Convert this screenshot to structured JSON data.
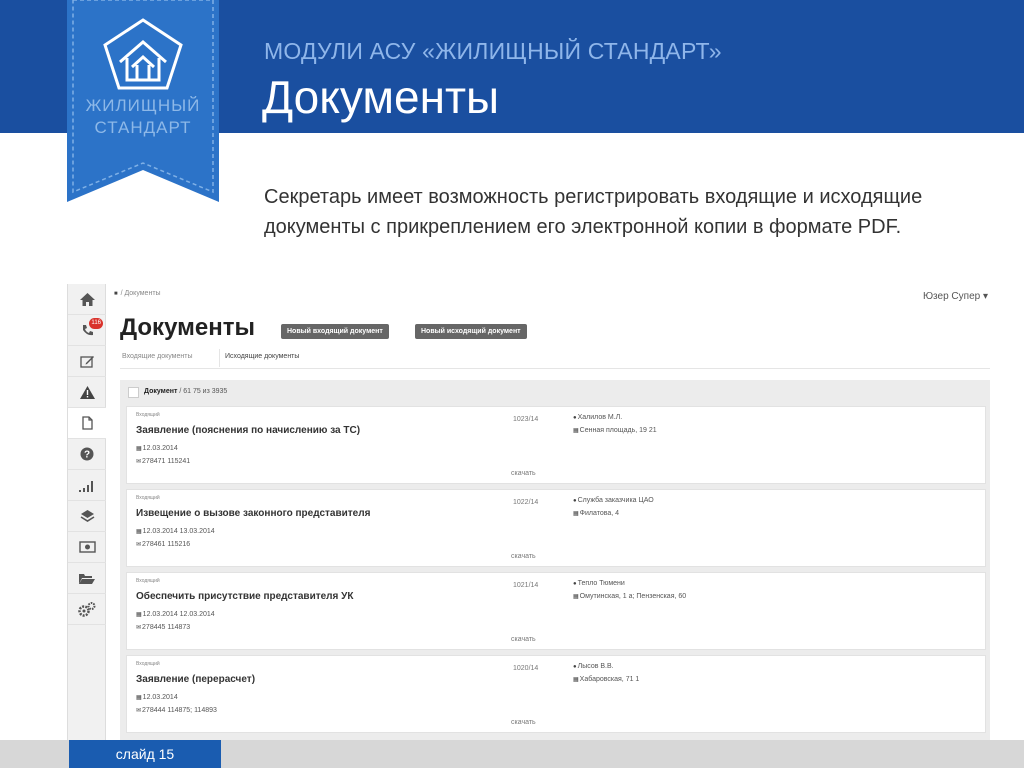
{
  "header": {
    "module_title": "МОДУЛИ АСУ «ЖИЛИЩНЫЙ СТАНДАРТ»",
    "page_heading": "Документы",
    "logo_line1": "ЖИЛИЩНЫЙ",
    "logo_line2": "СТАНДАРТ"
  },
  "description": "Секретарь имеет возможность регистрировать входящие и исходящие документы с прикреплением его электронной копии в формате PDF.",
  "app": {
    "sidebar": [
      {
        "icon": "home-icon",
        "badge": ""
      },
      {
        "icon": "phone-icon",
        "badge": "116"
      },
      {
        "icon": "edit-icon",
        "badge": ""
      },
      {
        "icon": "warning-icon",
        "badge": ""
      },
      {
        "icon": "document-icon",
        "badge": "",
        "active": true
      },
      {
        "icon": "question-icon",
        "badge": ""
      },
      {
        "icon": "signal-icon",
        "badge": ""
      },
      {
        "icon": "layers-icon",
        "badge": ""
      },
      {
        "icon": "money-icon",
        "badge": ""
      },
      {
        "icon": "folder-icon",
        "badge": ""
      },
      {
        "icon": "cogs-icon",
        "badge": ""
      }
    ],
    "breadcrumb": "Документы",
    "user_menu": "Юзер Супер ▾",
    "title": "Документы",
    "new_incoming_button": "Новый входящий документ",
    "new_outgoing_button": "Новый исходящий документ",
    "tabs": [
      "Входящие документы",
      "Исходящие документы"
    ],
    "list_label": "Документ",
    "list_count": " / 61 75 из 3935",
    "rows": [
      {
        "type": "Входящий",
        "title": "Заявление (пояснения по начислению за ТС)",
        "dates": "12.03.2014",
        "codes": "278471  115241",
        "number": "1023/14",
        "author": "Халилов М.Л.",
        "address": "Сенная площадь, 19   21",
        "download": "скачать"
      },
      {
        "type": "Входящий",
        "title": "Извещение о вызове законного представителя",
        "dates": "12.03.2014  13.03.2014",
        "codes": "278461  115216",
        "number": "1022/14",
        "author": "Служба заказчика ЦАО",
        "address": "Филатова, 4",
        "download": "скачать"
      },
      {
        "type": "Входящий",
        "title": "Обеспечить присутствие представителя УК",
        "dates": "12.03.2014  12.03.2014",
        "codes": "278445  114873",
        "number": "1021/14",
        "author": "Тепло Тюмени",
        "address": "Омутинская, 1 а; Пензенская, 60",
        "download": "скачать"
      },
      {
        "type": "Входящий",
        "title": "Заявление (перерасчет)",
        "dates": "12.03.2014",
        "codes": "278444  114875; 114893",
        "number": "1020/14",
        "author": "Лысов В.В.",
        "address": "Хабаровская, 71   1",
        "download": "скачать"
      }
    ]
  },
  "footer": {
    "slide_label": "слайд 15"
  },
  "colors": {
    "banner": "#1a4fa0",
    "accent": "#1a5cb0",
    "badge": "#d9322b"
  }
}
